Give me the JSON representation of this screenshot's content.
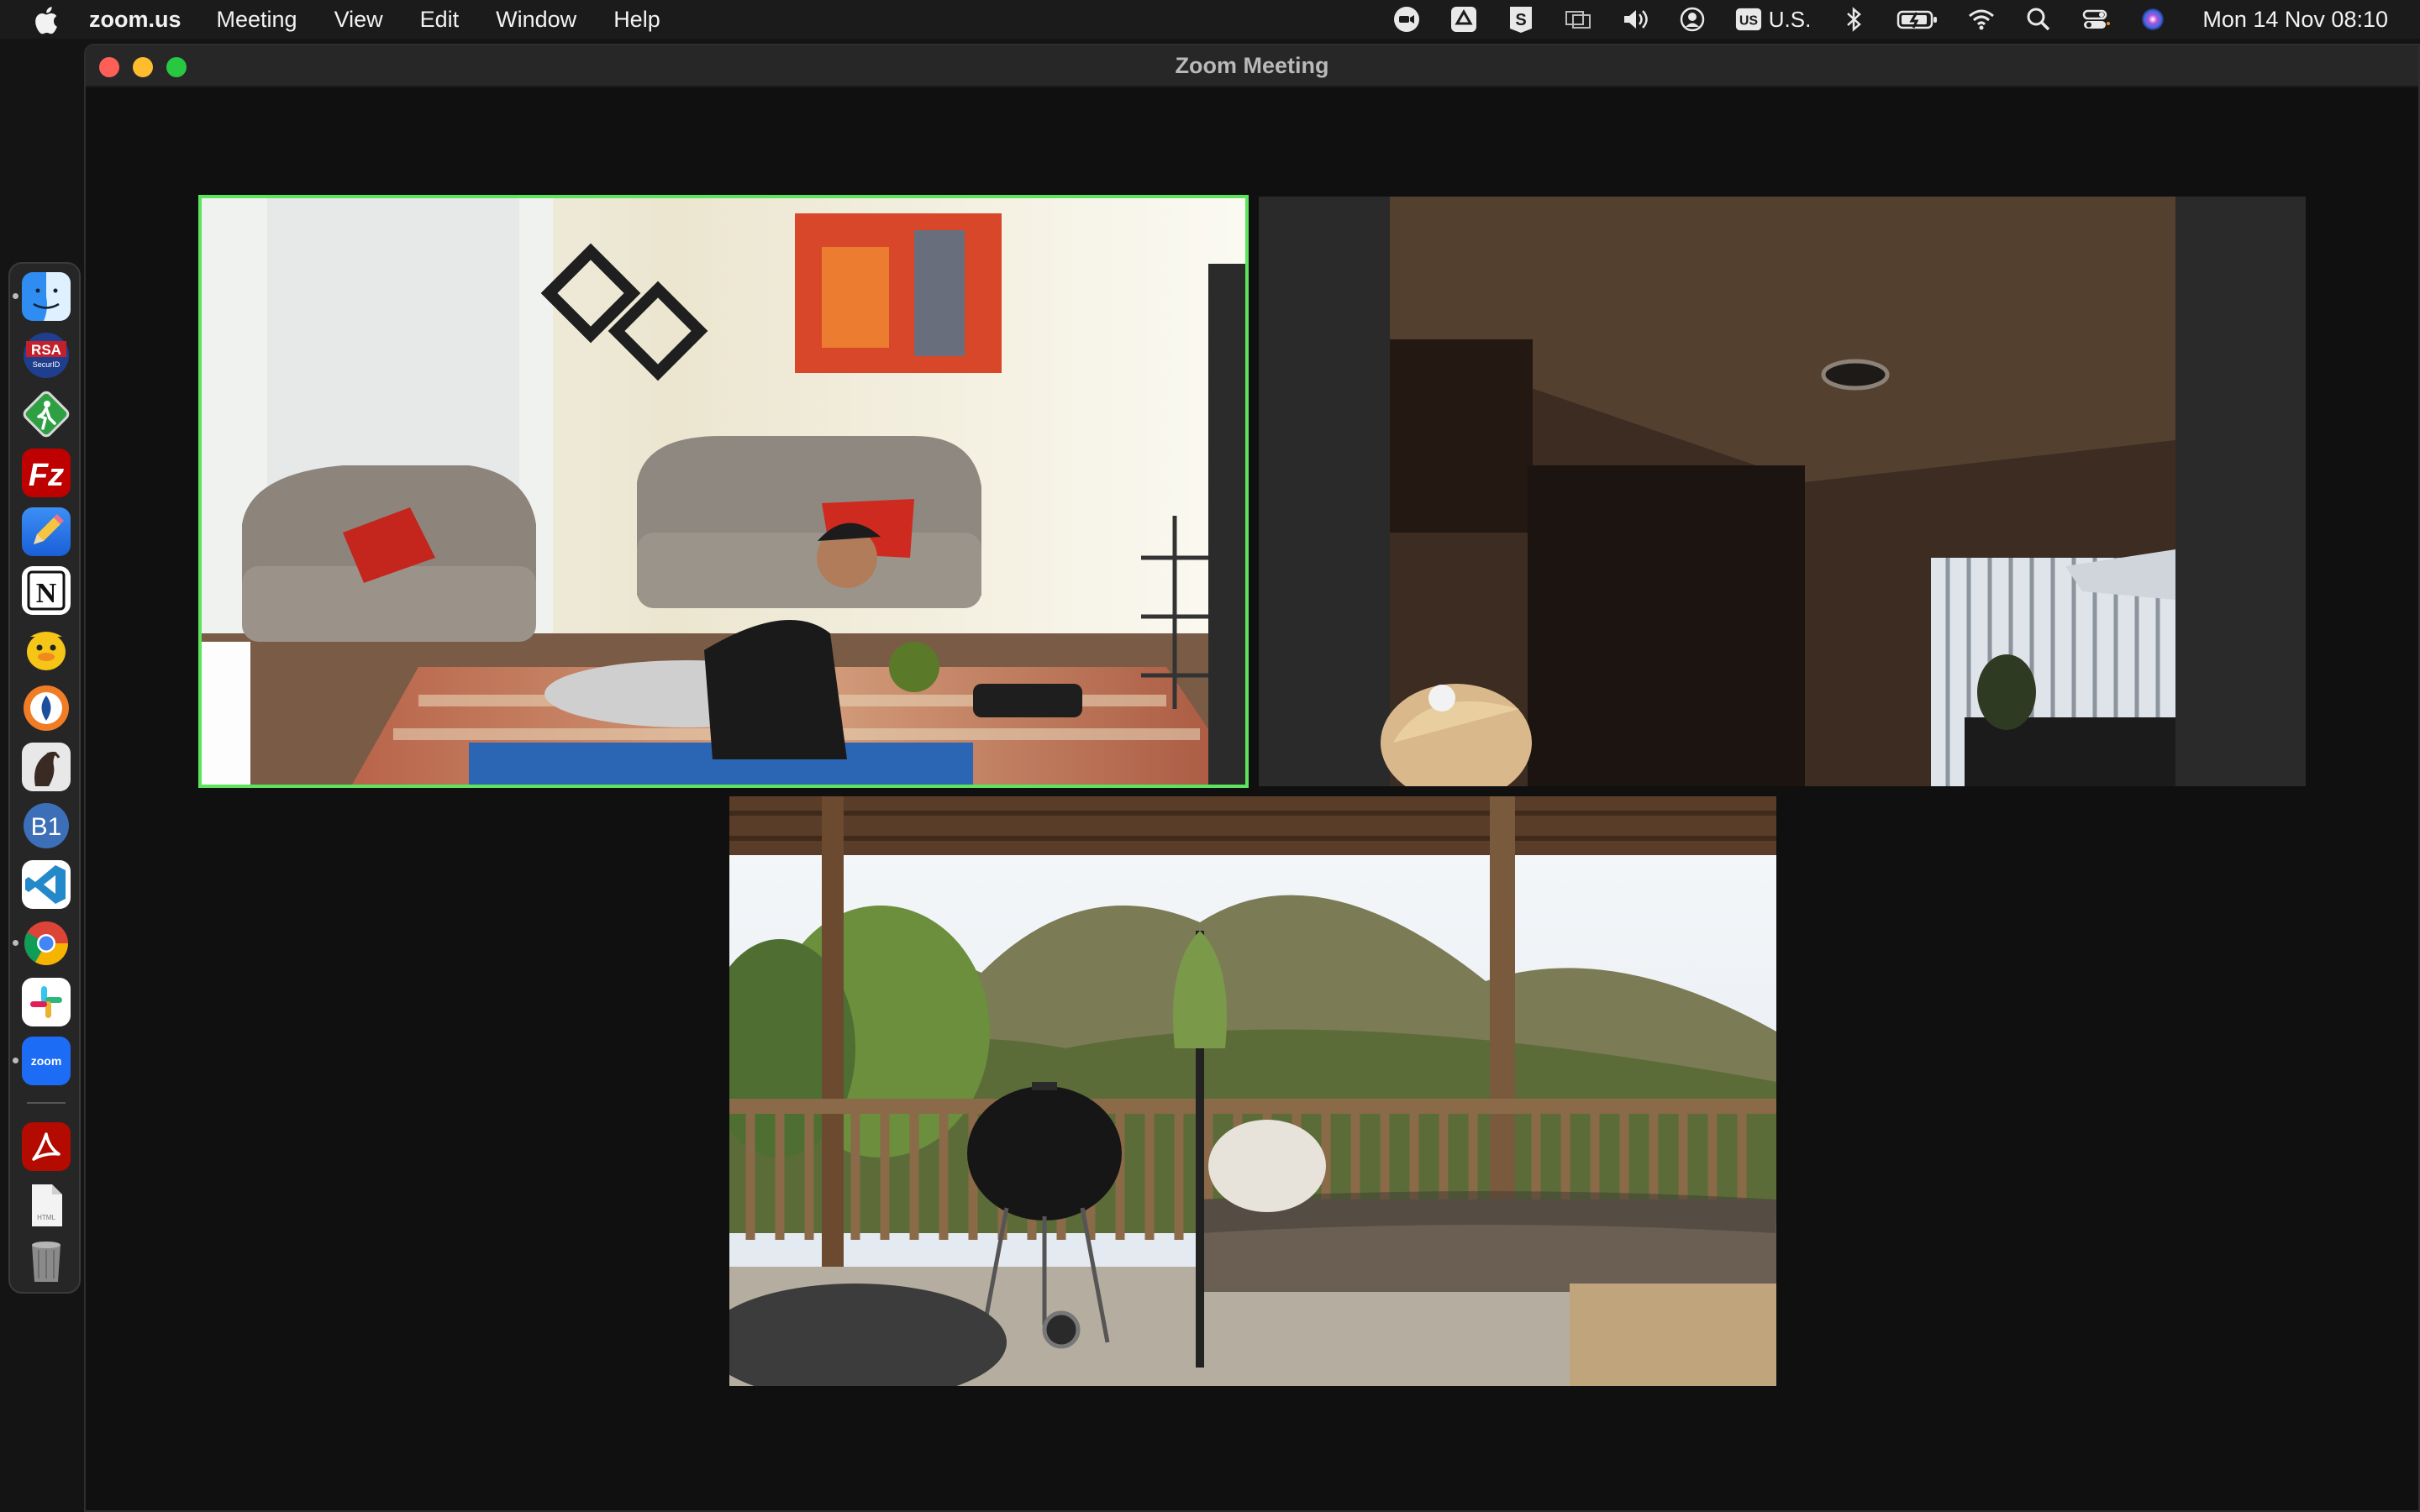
{
  "menubar": {
    "app_name": "zoom.us",
    "menus": [
      "Meeting",
      "View",
      "Edit",
      "Window",
      "Help"
    ],
    "status_icons": [
      "zoom-status-icon",
      "google-drive-icon",
      "scrivener-icon",
      "display-mirroring-icon",
      "volume-icon",
      "user-account-icon",
      "keyboard-input-icon",
      "bluetooth-icon",
      "battery-charging-icon",
      "wifi-icon",
      "spotlight-search-icon",
      "control-center-icon",
      "siri-icon"
    ],
    "input_source": "U.S.",
    "input_badge": "US",
    "clock": "Mon 14 Nov  08:10"
  },
  "dock": {
    "apps": [
      "finder-icon",
      "rsa-securid-icon",
      "pedestrian-sign-app-icon",
      "filezilla-icon",
      "pencil-app-icon",
      "notion-icon",
      "cyberduck-icon",
      "drop-icon",
      "sequel-ace-icon",
      "b1-app-icon",
      "vscode-icon",
      "chrome-icon",
      "slack-icon",
      "zoom-icon"
    ],
    "running": [
      "finder-icon",
      "chrome-icon",
      "zoom-icon"
    ],
    "others": [
      "acrobat-icon",
      "html-document-icon",
      "trash-icon"
    ],
    "labels": {
      "rsa": "RSA",
      "securid": "SecurID",
      "filezilla": "Fz",
      "notion": "N",
      "b1": "B1",
      "zoom": "zoom",
      "html": "HTML"
    }
  },
  "window": {
    "title": "Zoom Meeting"
  },
  "participants": [
    {
      "scene": "living-room-exercise",
      "active_speaker": true
    },
    {
      "scene": "dim-living-room",
      "active_speaker": false
    },
    {
      "scene": "porch-mountain-view",
      "active_speaker": false
    }
  ],
  "colors": {
    "active_speaker_border": "#5ee35e",
    "close": "#ff5f57",
    "minimize": "#febc2e",
    "zoom": "#28c840"
  }
}
